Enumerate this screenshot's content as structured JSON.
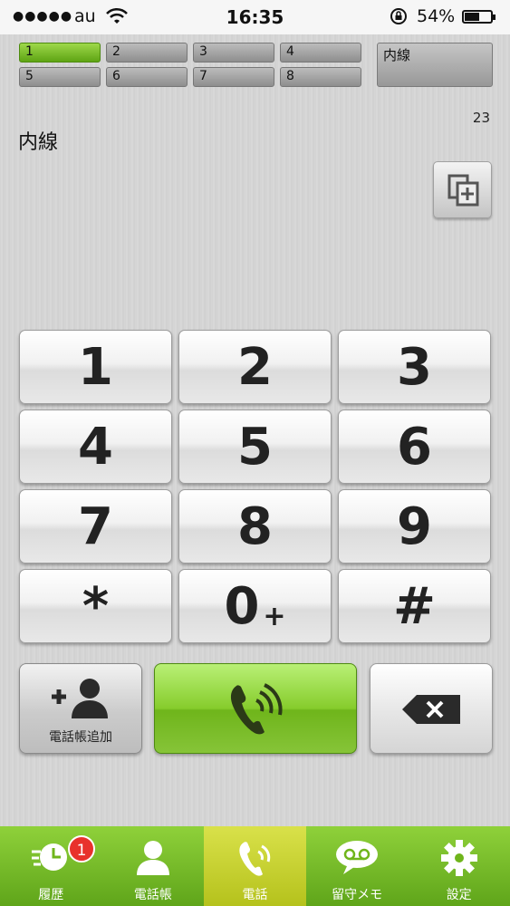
{
  "status": {
    "carrier": "au",
    "time": "16:35",
    "battery_percent": "54%"
  },
  "lines": {
    "buttons": [
      "1",
      "2",
      "3",
      "4",
      "5",
      "6",
      "7",
      "8"
    ],
    "active": "1",
    "extension_button": "内線"
  },
  "display": {
    "count": "23",
    "extension_label": "内線"
  },
  "keypad": {
    "keys": [
      "1",
      "2",
      "3",
      "4",
      "5",
      "6",
      "7",
      "8",
      "9",
      "*",
      "0",
      "#"
    ],
    "zero_sub": "+"
  },
  "actions": {
    "add_contact_label": "電話帳追加"
  },
  "tabbar": {
    "active": "電話",
    "history_badge": "1",
    "tabs": [
      {
        "label": "履歴",
        "icon": "history-icon"
      },
      {
        "label": "電話帳",
        "icon": "contacts-icon"
      },
      {
        "label": "電話",
        "icon": "phone-icon"
      },
      {
        "label": "留守メモ",
        "icon": "voicemail-icon"
      },
      {
        "label": "設定",
        "icon": "gear-icon"
      }
    ]
  },
  "colors": {
    "accent_green": "#6fb51b",
    "active_tab": "#c8d22e",
    "badge_red": "#e8312c"
  }
}
